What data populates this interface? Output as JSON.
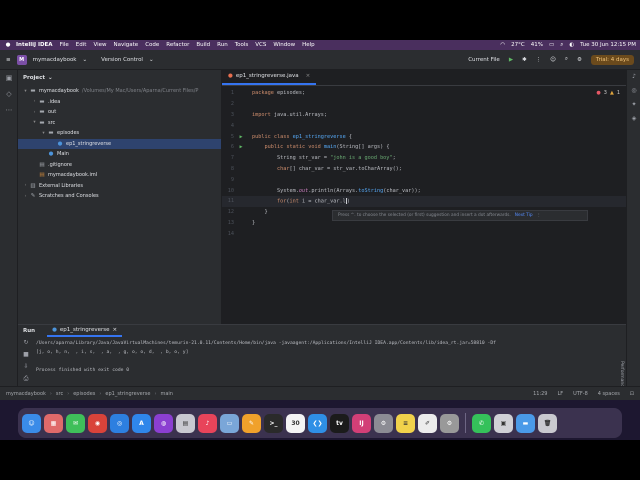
{
  "menubar": {
    "menus": [
      "IntelliJ IDEA",
      "File",
      "Edit",
      "View",
      "Navigate",
      "Code",
      "Refactor",
      "Build",
      "Run",
      "Tools",
      "VCS",
      "Window",
      "Help"
    ],
    "weather": "27°C",
    "battery": "41%",
    "datetime": "Tue 30 Jun  12:15 PM"
  },
  "toolbar": {
    "project_badge": "M",
    "project_name": "mymacdaybook",
    "version_control": "Version Control",
    "run_config": "Current File",
    "trial": "Trial: 4 days"
  },
  "project_panel": {
    "title": "Project",
    "tree": [
      {
        "indent": 0,
        "arrow": "▾",
        "icon": "folder",
        "label": "mymacdaybook",
        "muted": "/Volumes/My Mac/Users/Aparna/Current Files/P"
      },
      {
        "indent": 1,
        "arrow": "›",
        "icon": "folder",
        "label": ".idea",
        "muted": ""
      },
      {
        "indent": 1,
        "arrow": "›",
        "icon": "folder",
        "label": "out",
        "muted": ""
      },
      {
        "indent": 1,
        "arrow": "▾",
        "icon": "folder",
        "label": "src",
        "muted": ""
      },
      {
        "indent": 2,
        "arrow": "▾",
        "icon": "folder",
        "label": "episodes",
        "muted": ""
      },
      {
        "indent": 3,
        "arrow": "",
        "icon": "class",
        "label": "ep1_stringreverse",
        "muted": "",
        "selected": true
      },
      {
        "indent": 2,
        "arrow": "",
        "icon": "class",
        "label": "Main",
        "muted": ""
      },
      {
        "indent": 1,
        "arrow": "",
        "icon": "file",
        "label": ".gitignore",
        "muted": ""
      },
      {
        "indent": 1,
        "arrow": "",
        "icon": "xml",
        "label": "mymacdaybook.iml",
        "muted": ""
      },
      {
        "indent": 0,
        "arrow": "›",
        "icon": "lib",
        "label": "External Libraries",
        "muted": ""
      },
      {
        "indent": 0,
        "arrow": "›",
        "icon": "scratch",
        "label": "Scratches and Consoles",
        "muted": ""
      }
    ]
  },
  "editor": {
    "tab_label": "ep1_stringreverse.java",
    "inspections": {
      "errors": "3",
      "warnings": "1"
    },
    "lines": [
      {
        "n": "1",
        "html": "<span class='kw'>package</span> episodes;"
      },
      {
        "n": "2",
        "html": ""
      },
      {
        "n": "3",
        "html": "<span class='kw'>import</span> java.util.Arrays;"
      },
      {
        "n": "4",
        "html": ""
      },
      {
        "n": "5",
        "html": "<span class='kw'>public class</span> <span class='fn'>ep1_stringreverse</span> {",
        "run": true
      },
      {
        "n": "6",
        "html": "    <span class='kw'>public static void</span> <span class='fn'>main</span>(String[] args) {",
        "run": true
      },
      {
        "n": "7",
        "html": "        String str_var = <span class='str'>\"john is a good boy\"</span>;"
      },
      {
        "n": "8",
        "html": "        <span class='kw'>char</span>[] char_var = str_var.toCharArray();"
      },
      {
        "n": "9",
        "html": ""
      },
      {
        "n": "10",
        "html": "        System.<span class='fld'>out</span>.println(Arrays.<span class='fn'>toString</span>(char_var));"
      },
      {
        "n": "11",
        "html": "        <span class='kw'>for</span>(<span class='kw'>int</span> i = char_var.l<span class='cursor'></span>)",
        "current": true
      },
      {
        "n": "12",
        "html": "    }"
      },
      {
        "n": "13",
        "html": "}"
      },
      {
        "n": "14",
        "html": ""
      }
    ],
    "hint_text": "Press ^. to choose the selected (or first) suggestion and insert a dot afterwards.",
    "hint_next": "Next Tip"
  },
  "run_panel": {
    "title": "Run",
    "tab_label": "ep1_stringreverse",
    "console": [
      "/Users/aparna/Library/Java/JavaVirtualMachines/temurin-21.0.11/Contents/Home/bin/java -javaagent:/Applications/IntelliJ IDEA.app/Contents/lib/idea_rt.jar=58810 -Df",
      "[j, o, h, n,  , i, s,  , a,  , g, o, o, d,  , b, o, y]",
      "",
      "Process finished with exit code 0"
    ],
    "side_label": "Performance"
  },
  "statusbar": {
    "crumbs": [
      "mymacdaybook",
      "src",
      "episodes",
      "ep1_stringreverse",
      "main"
    ],
    "position": "11:29",
    "line_sep": "LF",
    "encoding": "UTF-8",
    "indent": "4 spaces"
  },
  "dock": {
    "apps": [
      {
        "name": "finder",
        "glyph": "☺",
        "color": "#3a8be8"
      },
      {
        "name": "launchpad",
        "glyph": "▦",
        "color": "#e06a6a"
      },
      {
        "name": "messages",
        "glyph": "✉",
        "color": "#3fbf5a"
      },
      {
        "name": "chrome",
        "glyph": "◉",
        "color": "#d9433a"
      },
      {
        "name": "safari",
        "glyph": "◎",
        "color": "#2d7fe0"
      },
      {
        "name": "app-store",
        "glyph": "A",
        "color": "#2f86ea"
      },
      {
        "name": "podcasts",
        "glyph": "◍",
        "color": "#8b3fd1"
      },
      {
        "name": "calendar-app",
        "glyph": "▤",
        "color": "#c8c8d0"
      },
      {
        "name": "music",
        "glyph": "♪",
        "color": "#e8445a"
      },
      {
        "name": "preview",
        "glyph": "▭",
        "color": "#7aa6d8"
      },
      {
        "name": "pages",
        "glyph": "✎",
        "color": "#f0a12b"
      },
      {
        "name": "terminal",
        "glyph": ">_",
        "color": "#2a2a2a"
      },
      {
        "name": "calendar",
        "glyph": "30",
        "color": "#f4f4f4"
      },
      {
        "name": "vscode",
        "glyph": "❮❯",
        "color": "#2f8fe6"
      },
      {
        "name": "apple-tv",
        "glyph": "tv",
        "color": "#1b1b1b"
      },
      {
        "name": "intellij",
        "glyph": "IJ",
        "color": "#d23f77"
      },
      {
        "name": "system-settings",
        "glyph": "⚙",
        "color": "#8c8c94"
      },
      {
        "name": "notes",
        "glyph": "≡",
        "color": "#f1d24b"
      },
      {
        "name": "textedit",
        "glyph": "✐",
        "color": "#ececec"
      },
      {
        "name": "settings-2",
        "glyph": "⚙",
        "color": "#999"
      },
      {
        "name": "whatsapp",
        "glyph": "✆",
        "color": "#35c15a"
      },
      {
        "name": "screen-capture",
        "glyph": "▣",
        "color": "#d0d0d6"
      },
      {
        "name": "folder",
        "glyph": "▬",
        "color": "#4a9ae8"
      },
      {
        "name": "trash",
        "glyph": "🗑",
        "color": "#c9c9cf"
      }
    ]
  }
}
